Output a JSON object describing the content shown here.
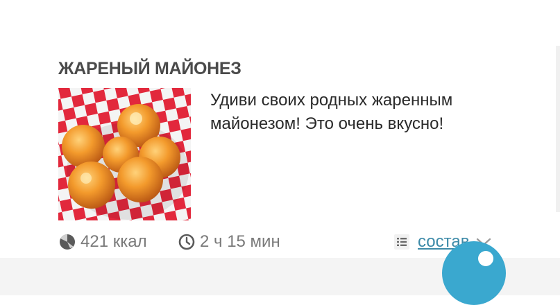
{
  "recipe": {
    "title": "ЖАРЕНЫЙ МАЙОНЕЗ",
    "description": "Удиви своих родных жаренным майонезом! Это очень вкусно!",
    "calories": "421 ккал",
    "cook_time": "2 ч 15 мин",
    "ingredients_label": "состав"
  },
  "icons": {
    "calories": "calories-gauge-icon",
    "time": "clock-icon",
    "list": "list-icon",
    "expand": "chevron-down-icon",
    "fab": "floating-action-button"
  },
  "colors": {
    "title": "#4a4a4a",
    "link": "#3c8aa8",
    "meta": "#7a7a7a",
    "accent": "#3aa8cf"
  }
}
